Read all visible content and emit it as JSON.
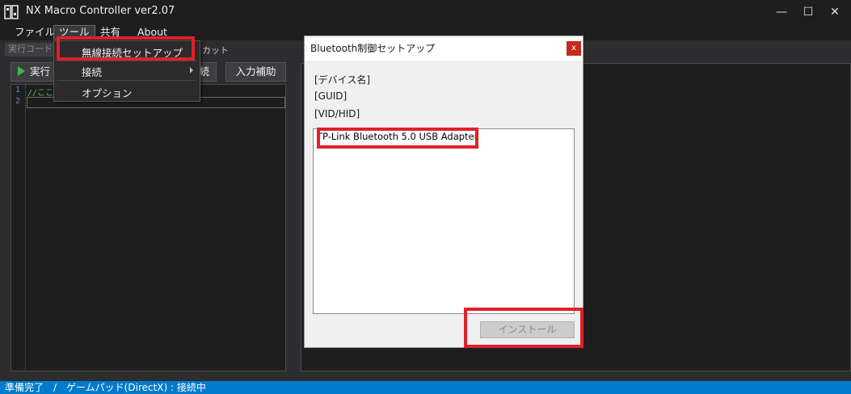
{
  "window": {
    "title": "NX Macro Controller ver2.07",
    "minimize": "—",
    "maximize": "☐",
    "close": "✕"
  },
  "menubar": {
    "items": [
      "ファイル",
      "ツール",
      "共有",
      "About"
    ]
  },
  "tabs": {
    "code": "実行コード",
    "shortcut": "カット"
  },
  "toolbar": {
    "run": "実行",
    "partial": "続",
    "input_assist": "入力補助"
  },
  "editor": {
    "line_numbers": [
      "1",
      "2"
    ],
    "line1": "//ここに"
  },
  "tools_menu": {
    "items": [
      "無線接続セットアップ",
      "接続",
      "オプション"
    ]
  },
  "dialog": {
    "title": "Bluetooth制御セットアップ",
    "close": "x",
    "labels": [
      "[デバイス名]",
      "[GUID]",
      "[VID/HID]"
    ],
    "devices": [
      "TP-Link Bluetooth 5.0 USB Adapter"
    ],
    "install_button": "インストール"
  },
  "statusbar": {
    "text": "準備完了　/　ゲームパッド(DirectX) : 接続中"
  },
  "colors": {
    "accent": "#007acc",
    "highlight": "#e0202a",
    "background": "#2d2d30",
    "run_green": "#3fb950"
  }
}
